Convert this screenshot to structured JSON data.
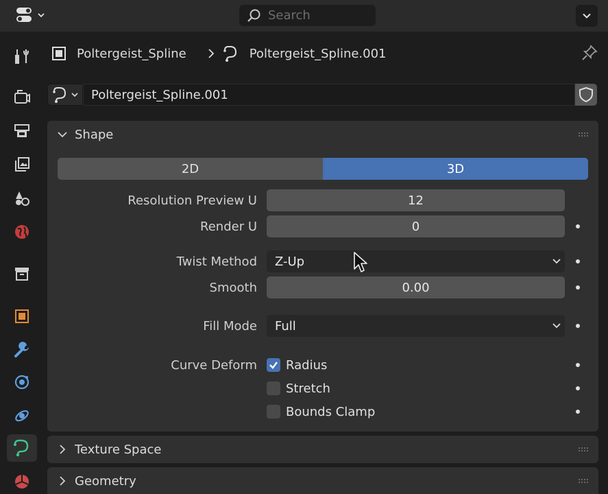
{
  "header": {
    "search_placeholder": "Search"
  },
  "tabs": [
    "tool-icon",
    "render-icon",
    "output-icon",
    "view-layer-icon",
    "scene-icon",
    "world-icon",
    "collection-icon",
    "object-icon",
    "modifier-icon",
    "particles-icon",
    "physics-icon",
    "curve-data-icon",
    "material-icon"
  ],
  "breadcrumb": {
    "object": "Poltergeist_Spline",
    "data": "Poltergeist_Spline.001"
  },
  "datablock": {
    "name": "Poltergeist_Spline.001"
  },
  "shape": {
    "title": "Shape",
    "dim_2d": "2D",
    "dim_3d": "3D",
    "resolution_preview_label": "Resolution Preview U",
    "resolution_preview_value": "12",
    "render_u_label": "Render U",
    "render_u_value": "0",
    "twist_label": "Twist Method",
    "twist_value": "Z-Up",
    "smooth_label": "Smooth",
    "smooth_value": "0.00",
    "fill_label": "Fill Mode",
    "fill_value": "Full",
    "deform_label": "Curve Deform",
    "radius_label": "Radius",
    "radius_checked": true,
    "stretch_label": "Stretch",
    "stretch_checked": false,
    "bounds_label": "Bounds Clamp",
    "bounds_checked": false
  },
  "panels": {
    "texture_space": "Texture Space",
    "geometry": "Geometry"
  },
  "colors": {
    "accent": "#4772b3",
    "panel": "#303030",
    "background": "#1d1d1d"
  }
}
